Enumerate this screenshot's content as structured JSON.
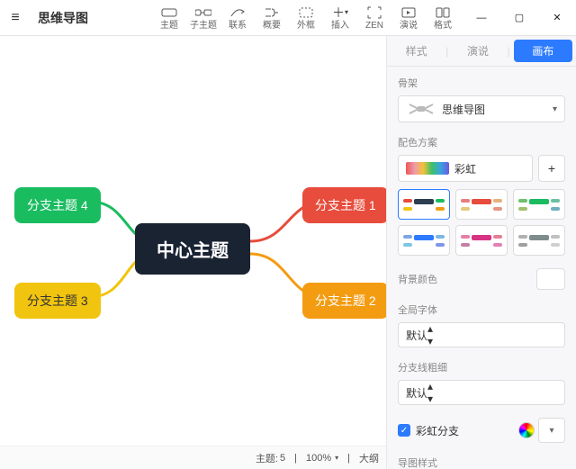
{
  "title": "思维导图",
  "toolbar": [
    {
      "label": "主题",
      "icon": "topic-icon"
    },
    {
      "label": "子主题",
      "icon": "subtopic-icon"
    },
    {
      "label": "联系",
      "icon": "relation-icon"
    },
    {
      "label": "概要",
      "icon": "summary-icon"
    },
    {
      "label": "外框",
      "icon": "boundary-icon"
    },
    {
      "label": "插入",
      "icon": "insert-icon"
    },
    {
      "label": "ZEN",
      "icon": "zen-icon"
    },
    {
      "label": "演说",
      "icon": "pitch-icon"
    },
    {
      "label": "格式",
      "icon": "format-icon"
    }
  ],
  "mindmap": {
    "center": "中心主题",
    "branches": [
      {
        "label": "分支主题 4",
        "color": "green"
      },
      {
        "label": "分支主题 1",
        "color": "red"
      },
      {
        "label": "分支主题 3",
        "color": "yellow"
      },
      {
        "label": "分支主题 2",
        "color": "orange"
      }
    ]
  },
  "status": {
    "topic_label": "主题:",
    "topic_count": "5",
    "zoom": "100%",
    "outline": "大纲"
  },
  "panel": {
    "tabs": [
      "样式",
      "演说",
      "画布"
    ],
    "active_tab": 2,
    "skeleton": {
      "label": "骨架",
      "value": "思维导图"
    },
    "scheme": {
      "label": "配色方案",
      "value": "彩虹"
    },
    "background": {
      "label": "背景颜色"
    },
    "font": {
      "label": "全局字体",
      "value": "默认"
    },
    "linewidth": {
      "label": "分支线粗细",
      "value": "默认"
    },
    "rainbow_branch": {
      "label": "彩虹分支",
      "checked": true
    },
    "map_style": {
      "label": "导图样式"
    }
  }
}
